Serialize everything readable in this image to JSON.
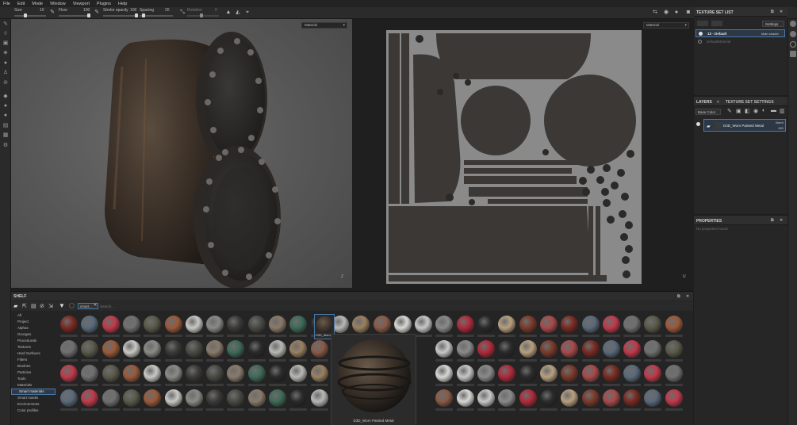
{
  "menubar": {
    "items": [
      "File",
      "Edit",
      "Mode",
      "Window",
      "Viewport",
      "Plugins",
      "Help"
    ]
  },
  "tool_options": {
    "size_label": "Size",
    "size_value": "10",
    "flow_label": "Flow",
    "flow_value": "100",
    "stroke_opacity_label": "Stroke opacity",
    "stroke_opacity_value": "100",
    "spacing_label": "Spacing",
    "spacing_value": "20",
    "rotation_label": "Rotation",
    "rotation_value": "0"
  },
  "viewport3d": {
    "dropdown": "Material",
    "axis_label": "Z"
  },
  "viewport2d": {
    "dropdown": "Material",
    "axis_label": "U"
  },
  "texture_set_list": {
    "title": "TEXTURE SET LIST",
    "settings": "Settings",
    "items": [
      {
        "name": "13 - Default",
        "shader": "Main shader"
      },
      {
        "name": "DefaultMaterial",
        "shader": ""
      }
    ]
  },
  "layers_panel": {
    "tab_layers": "LAYERS",
    "tab_settings": "TEXTURE SET SETTINGS",
    "channel": "Base Color",
    "layer": {
      "name": "D3D_Worn Painted Metal",
      "blend": "Norm",
      "opacity": "100"
    }
  },
  "properties_panel": {
    "title": "PROPERTIES",
    "empty_text": "No properties found"
  },
  "shelf": {
    "title": "SHELF",
    "filter_tag": "smart...",
    "search_placeholder": "Search...",
    "categories": [
      "All",
      "Project",
      "Alphas",
      "Grunges",
      "Procedurals",
      "Textures",
      "Hard Surfaces",
      "Filters",
      "Brushes",
      "Particles",
      "Tools",
      "Materials",
      "Smart materials",
      "Smart masks",
      "Environments",
      "Color profiles"
    ],
    "selected_category": "Smart materials",
    "hover_item_short": "D3D_Worn",
    "preview_name": "D3D_Worn Painted Metal"
  },
  "colors": {
    "accent": "#4a78a8",
    "panel": "#262626",
    "viewport_bg": "#5b5b5b"
  }
}
